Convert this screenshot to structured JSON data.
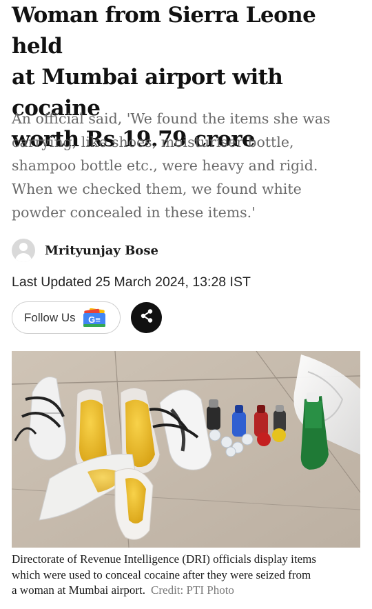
{
  "article": {
    "headline_lines": [
      "Woman from Sierra Leone held",
      "at Mumbai airport with cocaine",
      "worth Rs 19.79 crore"
    ],
    "summary_lines": [
      "An official said, 'We found the items she was",
      "carrying, like shoes, moisturiser bottle,",
      "shampoo bottle etc., were heavy and rigid.",
      "When we checked them, we found white",
      "powder concealed in these items.'"
    ],
    "author": "Mrityunjay Bose",
    "last_updated": "Last Updated 25 March 2024, 13:28 IST"
  },
  "actions": {
    "follow_label": "Follow Us",
    "gnews_icon_text": "G≡"
  },
  "photo": {
    "caption_lines": [
      "Directorate of Revenue Intelligence (DRI) officials display items",
      "which were used to conceal cocaine after they were seized from",
      "a woman at Mumbai airport."
    ],
    "credit": "Credit: PTI Photo"
  },
  "colors": {
    "headline": "#111111",
    "summary": "#6a6a6a",
    "share_button": "#111111",
    "gnews_blue": "#4285f4",
    "gnews_red": "#ea4335",
    "gnews_yellow": "#fbbc05",
    "gnews_green": "#34a853"
  }
}
